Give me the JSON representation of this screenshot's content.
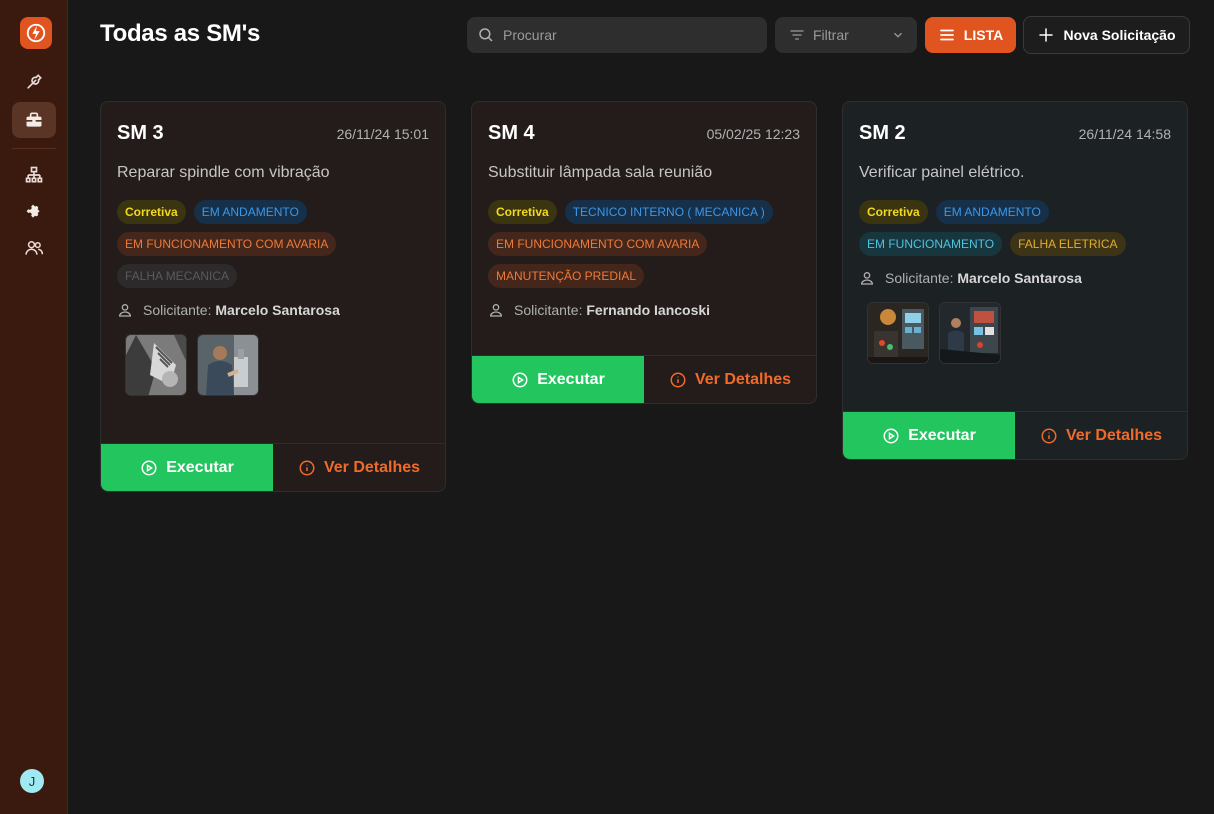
{
  "sidebar": {
    "logo_icon": "lightning-icon",
    "items": [
      {
        "icon": "wrench-icon"
      },
      {
        "icon": "toolbox-icon",
        "active": true
      },
      {
        "icon": "hierarchy-icon"
      },
      {
        "icon": "puzzle-icon"
      },
      {
        "icon": "users-icon"
      }
    ],
    "avatar_initial": "J"
  },
  "header": {
    "title": "Todas as SM's",
    "search_placeholder": "Procurar",
    "filter_label": "Filtrar",
    "list_label": "LISTA",
    "new_label": "Nova Solicitação"
  },
  "colors": {
    "accent": "#e0541f",
    "execute": "#22c55e",
    "sidebar": "#3a1a0e"
  },
  "cards": [
    {
      "title": "SM 3",
      "date": "26/11/24 15:01",
      "description": "Reparar spindle com vibração",
      "tags": [
        {
          "label": "Corretiva",
          "color": "yellow"
        },
        {
          "label": "EM ANDAMENTO",
          "color": "blue"
        },
        {
          "label": "EM FUNCIONAMENTO COM AVARIA",
          "color": "orange"
        },
        {
          "label": "FALHA MECANICA",
          "color": "gray"
        }
      ],
      "requester_label": "Solicitante:",
      "requester_name": "Marcelo Santarosa",
      "execute_label": "Executar",
      "details_label": "Ver Detalhes"
    },
    {
      "title": "SM 4",
      "date": "05/02/25 12:23",
      "description": "Substituir lâmpada sala reunião",
      "tags": [
        {
          "label": "Corretiva",
          "color": "yellow"
        },
        {
          "label": "TECNICO INTERNO ( MECANICA )",
          "color": "blue"
        },
        {
          "label": "EM FUNCIONAMENTO COM AVARIA",
          "color": "orange"
        },
        {
          "label": "MANUTENÇÃO PREDIAL",
          "color": "orange"
        }
      ],
      "requester_label": "Solicitante:",
      "requester_name": "Fernando Iancoski",
      "execute_label": "Executar",
      "details_label": "Ver Detalhes"
    },
    {
      "title": "SM 2",
      "date": "26/11/24 14:58",
      "description": "Verificar painel elétrico.",
      "tags": [
        {
          "label": "Corretiva",
          "color": "yellow"
        },
        {
          "label": "EM ANDAMENTO",
          "color": "blue"
        },
        {
          "label": "EM FUNCIONAMENTO",
          "color": "cyan"
        },
        {
          "label": "FALHA ELETRICA",
          "color": "amber"
        }
      ],
      "requester_label": "Solicitante:",
      "requester_name": "Marcelo Santarosa",
      "execute_label": "Executar",
      "details_label": "Ver Detalhes"
    }
  ]
}
